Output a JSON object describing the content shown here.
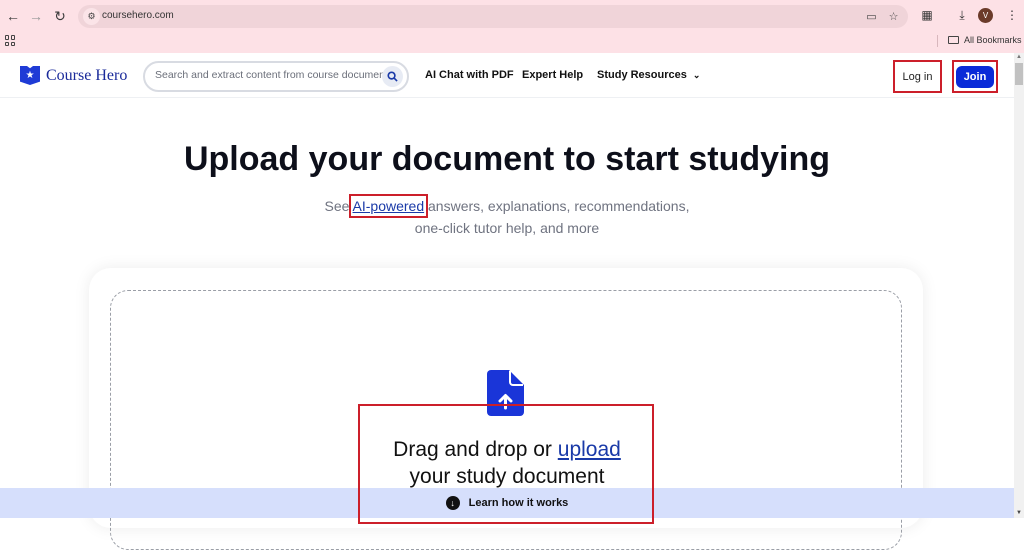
{
  "browser": {
    "url": "coursehero.com",
    "bookmarks_label": "All Bookmarks",
    "profile_initial": "V"
  },
  "header": {
    "logo_text": "Course Hero",
    "search_placeholder": "Search and extract content from course documents,",
    "nav": [
      {
        "label": "AI Chat with PDF"
      },
      {
        "label": "Expert Help"
      },
      {
        "label": "Study Resources"
      }
    ],
    "login_label": "Log in",
    "join_label": "Join"
  },
  "hero": {
    "title": "Upload your document to start studying",
    "subtitle_prefix": "See ",
    "subtitle_link": "AI-powered",
    "subtitle_rest": " answers, explanations, recommendations,",
    "subtitle_line2": "one-click tutor help, and more"
  },
  "upload": {
    "text_prefix": "Drag and drop or ",
    "upload_link": "upload",
    "text_line2": "your study document"
  },
  "footer_bar": {
    "label": "Learn how it works"
  },
  "colors": {
    "brand": "#1f3bd6",
    "join_button": "#0a2ad8",
    "annotation_red": "#cc1f2a",
    "learn_bar": "#d6dffc"
  }
}
